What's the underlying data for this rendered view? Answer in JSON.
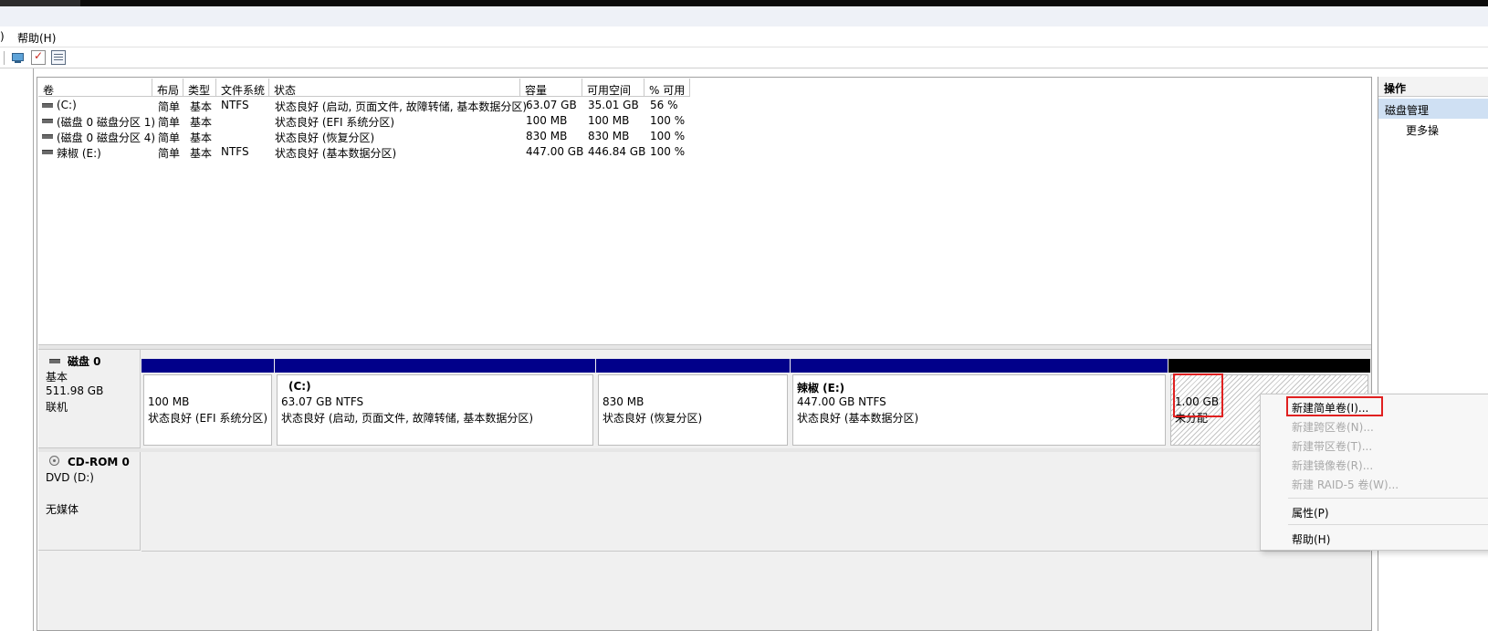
{
  "menubar": {
    "paren": ")",
    "help": "帮助(H)"
  },
  "toolbar": {
    "icons": [
      "computer-icon",
      "checklist-icon",
      "properties-icon"
    ]
  },
  "volume_table": {
    "columns": [
      "卷",
      "布局",
      "类型",
      "文件系统",
      "状态",
      "容量",
      "可用空间",
      "% 可用"
    ],
    "rows": [
      {
        "volume": "(C:)",
        "layout": "简单",
        "type": "基本",
        "fs": "NTFS",
        "status": "状态良好 (启动, 页面文件, 故障转储, 基本数据分区)",
        "capacity": "63.07 GB",
        "free": "35.01 GB",
        "pct": "56 %"
      },
      {
        "volume": "(磁盘 0 磁盘分区 1)",
        "layout": "简单",
        "type": "基本",
        "fs": "",
        "status": "状态良好 (EFI 系统分区)",
        "capacity": "100 MB",
        "free": "100 MB",
        "pct": "100 %"
      },
      {
        "volume": "(磁盘 0 磁盘分区 4)",
        "layout": "简单",
        "type": "基本",
        "fs": "",
        "status": "状态良好 (恢复分区)",
        "capacity": "830 MB",
        "free": "830 MB",
        "pct": "100 %"
      },
      {
        "volume": "辣椒 (E:)",
        "layout": "简单",
        "type": "基本",
        "fs": "NTFS",
        "status": "状态良好 (基本数据分区)",
        "capacity": "447.00 GB",
        "free": "446.84 GB",
        "pct": "100 %"
      }
    ]
  },
  "disk0": {
    "name": "磁盘 0",
    "kind": "基本",
    "size": "511.98 GB",
    "state": "联机",
    "partitions": [
      {
        "title": "",
        "size": "100 MB",
        "status": "状态良好 (EFI 系统分区)"
      },
      {
        "title": "(C:)",
        "size": "63.07 GB NTFS",
        "status": "状态良好 (启动, 页面文件, 故障转储, 基本数据分区)"
      },
      {
        "title": "",
        "size": "830 MB",
        "status": "状态良好 (恢复分区)"
      },
      {
        "title": "辣椒  (E:)",
        "size": "447.00 GB NTFS",
        "status": "状态良好 (基本数据分区)"
      }
    ],
    "unallocated": {
      "size": "1.00 GB",
      "label": "未分配"
    }
  },
  "cdrom": {
    "name": "CD-ROM 0",
    "drive": "DVD (D:)",
    "media": "无媒体"
  },
  "actions_panel": {
    "header": "操作",
    "section": "磁盘管理",
    "more": "更多操"
  },
  "context_menu": {
    "items": [
      {
        "label": "新建简单卷(I)...",
        "enabled": true
      },
      {
        "label": "新建跨区卷(N)...",
        "enabled": false
      },
      {
        "label": "新建带区卷(T)...",
        "enabled": false
      },
      {
        "label": "新建镜像卷(R)...",
        "enabled": false
      },
      {
        "label": "新建 RAID-5 卷(W)...",
        "enabled": false
      },
      {
        "label": "属性(P)",
        "enabled": true
      },
      {
        "label": "帮助(H)",
        "enabled": true
      }
    ]
  },
  "colors": {
    "partition_bar": "#01008a",
    "unallocated_bar": "#000000",
    "highlight_box": "#e02020"
  }
}
